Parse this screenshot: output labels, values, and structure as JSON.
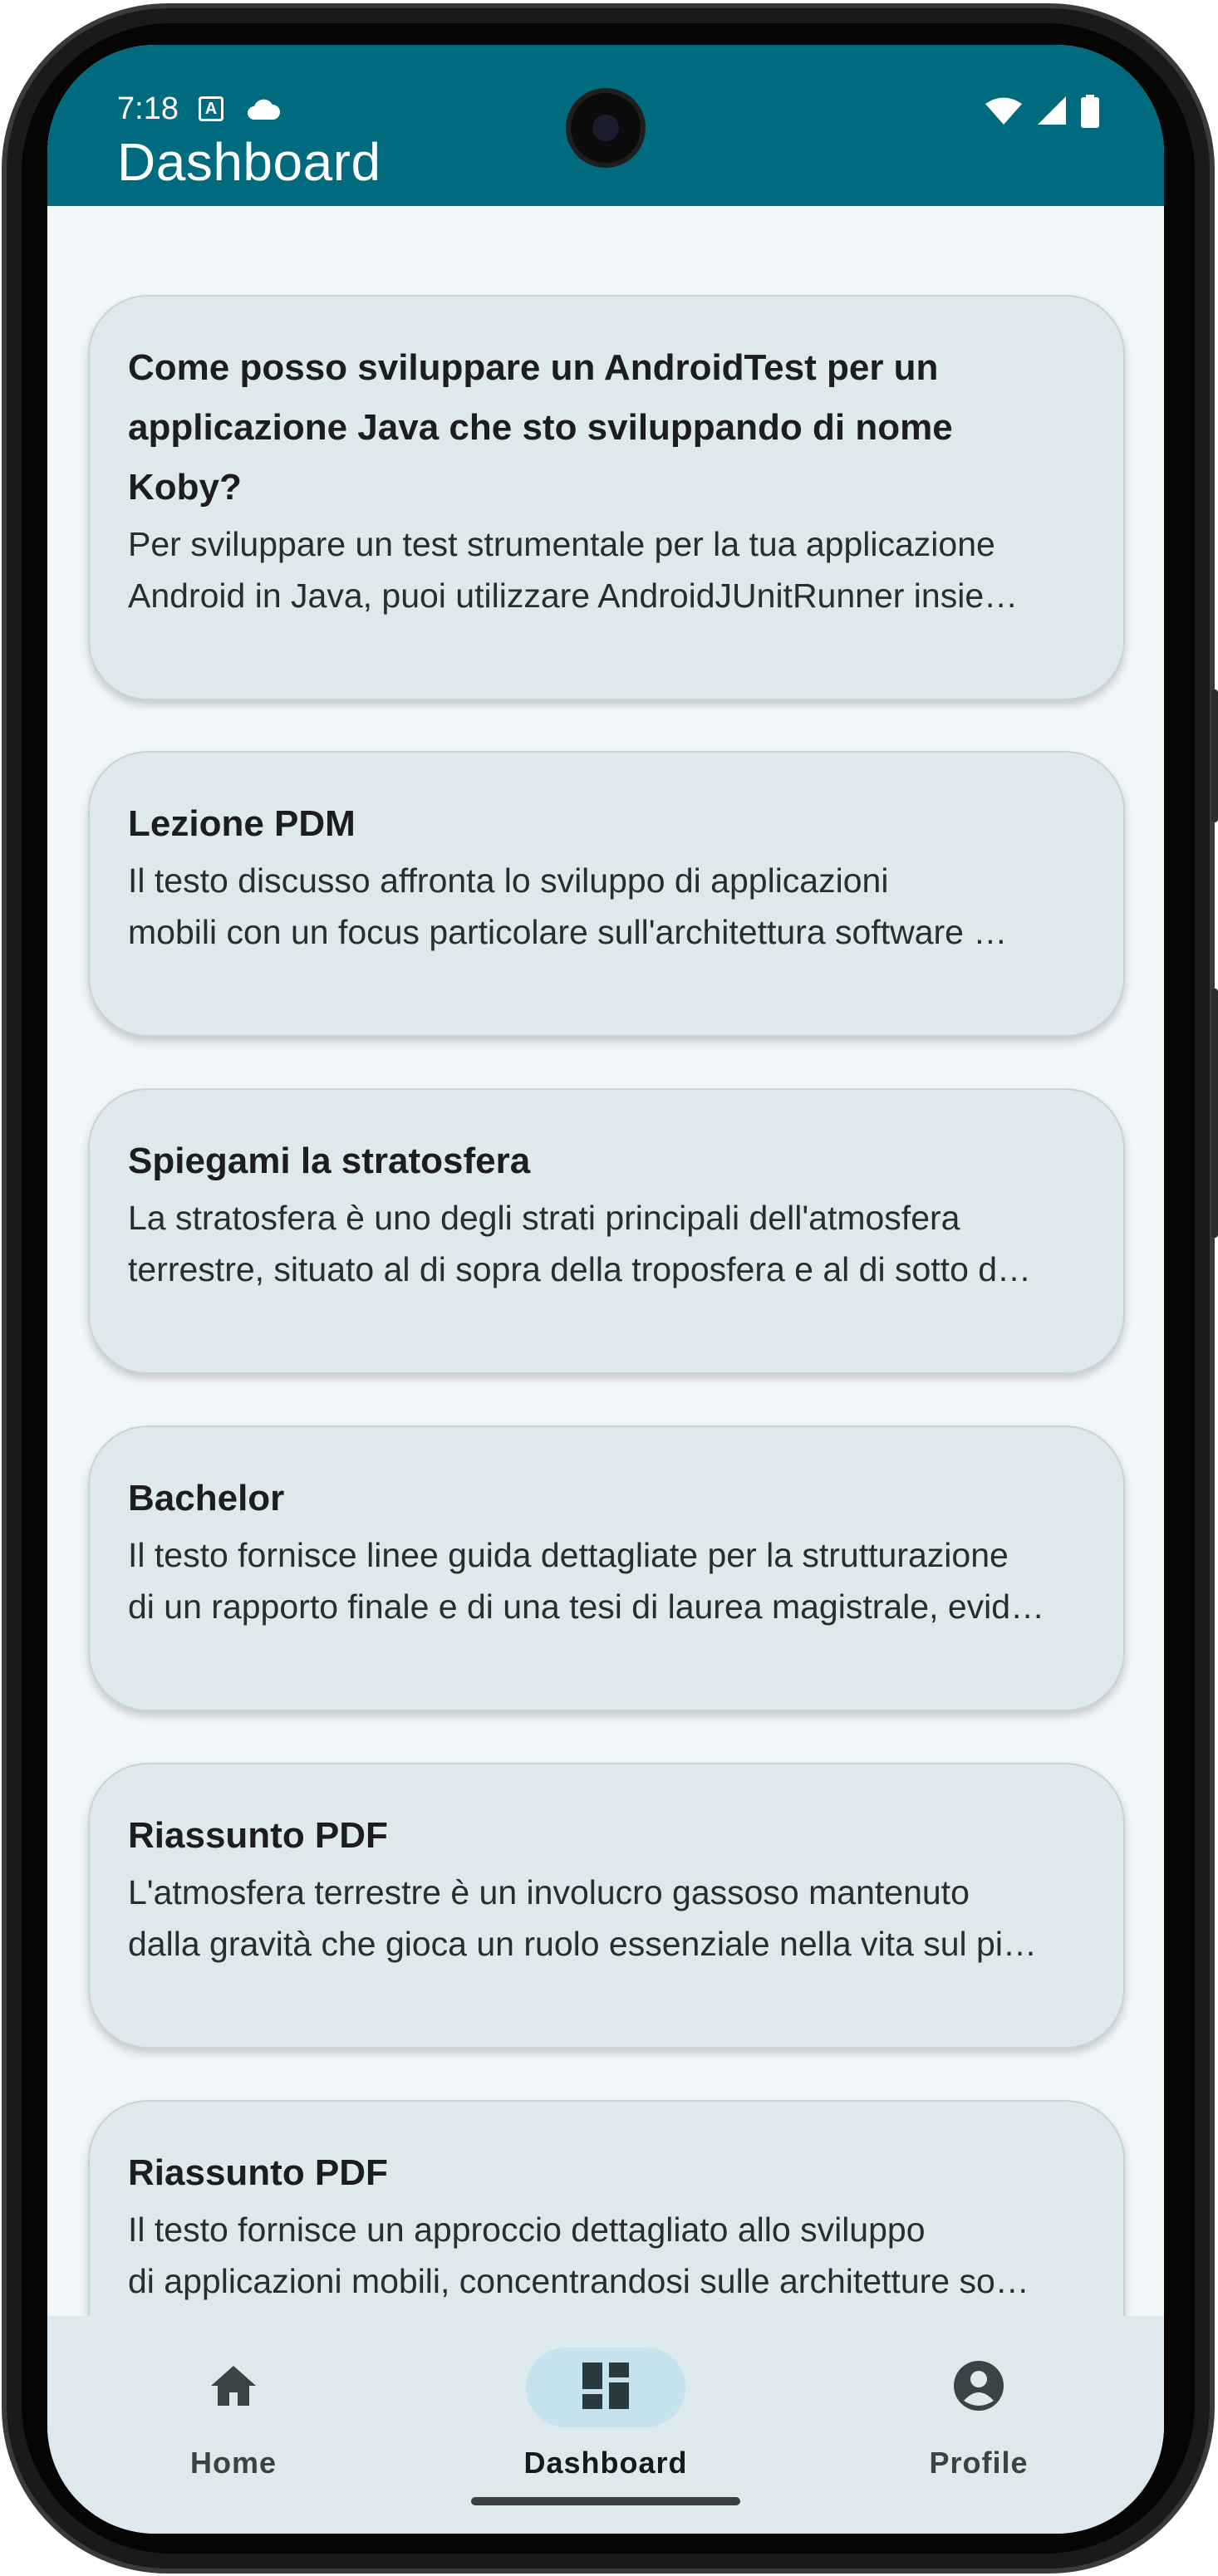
{
  "status_bar": {
    "time": "7:18",
    "keyboard_badge": "A"
  },
  "header": {
    "title": "Dashboard"
  },
  "cards": [
    {
      "title_line1": "Come posso sviluppare un AndroidTest per un",
      "title_line2": "applicazione Java che sto sviluppando di nome",
      "title_line3": "Koby?",
      "text_line1": "Per sviluppare un test strumentale per la tua applicazione",
      "text_line2": "Android in Java, puoi utilizzare AndroidJUnitRunner insie…"
    },
    {
      "title": "Lezione PDM",
      "text_line1": "Il testo discusso affronta lo sviluppo di applicazioni",
      "text_line2": "mobili con un focus particolare sull'architettura software …"
    },
    {
      "title": "Spiegami la stratosfera",
      "text_line1": "La stratosfera è uno degli strati principali dell'atmosfera",
      "text_line2": "terrestre, situato al di sopra della troposfera e al di sotto d…"
    },
    {
      "title": "Bachelor",
      "text_line1": "Il testo fornisce linee guida dettagliate per la strutturazione",
      "text_line2": "di un rapporto finale e di una tesi di laurea magistrale, evid…"
    },
    {
      "title": "Riassunto PDF",
      "text_line1": "L'atmosfera terrestre è un involucro gassoso mantenuto",
      "text_line2": "dalla gravità che gioca un ruolo essenziale nella vita sul pi…"
    },
    {
      "title": "Riassunto PDF",
      "text_line1": "Il testo fornisce un approccio dettagliato allo sviluppo",
      "text_line2": "di applicazioni mobili, concentrandosi sulle architetture so…"
    }
  ],
  "bottom_nav": {
    "items": [
      {
        "label": "Home",
        "icon": "home-icon",
        "active": false
      },
      {
        "label": "Dashboard",
        "icon": "dashboard-icon",
        "active": true
      },
      {
        "label": "Profile",
        "icon": "account-circle-icon",
        "active": false
      }
    ]
  },
  "colors": {
    "top_bar": "#006a7e",
    "card_bg": "#dde9ec",
    "screen_bg": "#f1f6f8",
    "nav_active_pill": "#c5e3ec"
  }
}
